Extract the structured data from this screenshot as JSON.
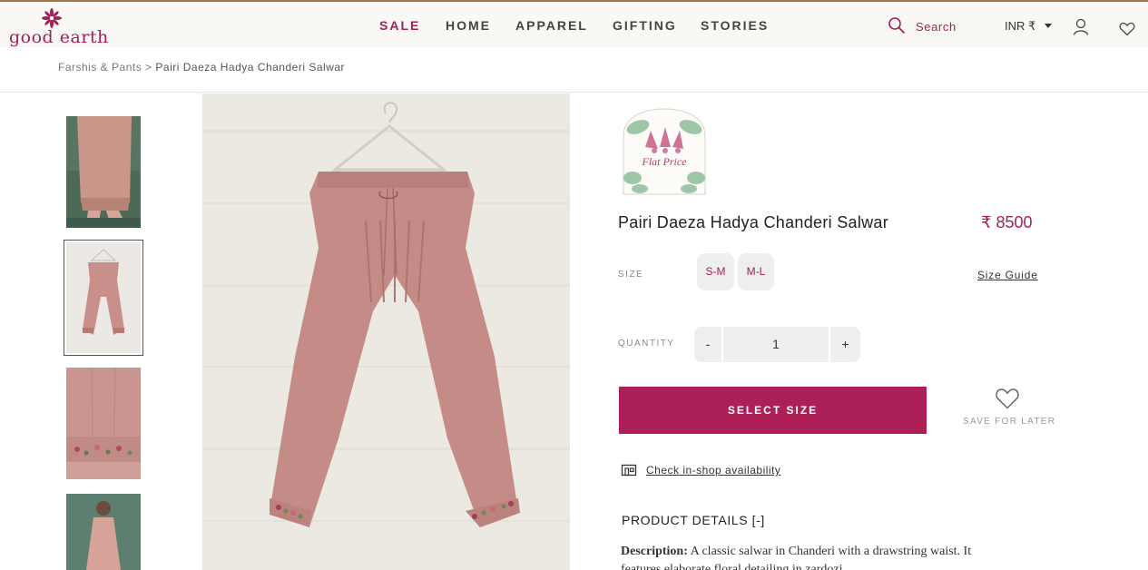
{
  "brand": {
    "name": "good earth"
  },
  "nav": {
    "sale": "SALE",
    "home": "HOME",
    "apparel": "APPAREL",
    "gifting": "GIFTING",
    "stories": "STORIES"
  },
  "header": {
    "search_label": "Search",
    "currency": "INR ₹"
  },
  "breadcrumb": {
    "parent": "Farshis & Pants",
    "separator": ">",
    "current": "Pairi Daeza Hadya Chanderi Salwar"
  },
  "badge": {
    "text": "Flat Price"
  },
  "product": {
    "title": "Pairi Daeza Hadya Chanderi Salwar",
    "price": "₹ 8500"
  },
  "size": {
    "label": "SIZE",
    "options": [
      "S-M",
      "M-L"
    ],
    "guide": "Size Guide"
  },
  "quantity": {
    "label": "QUANTITY",
    "minus": "-",
    "value": "1",
    "plus": "+"
  },
  "actions": {
    "select_size": "SELECT SIZE",
    "save_for_later": "SAVE FOR LATER",
    "check_availability": "Check in-shop availability"
  },
  "details": {
    "heading": "PRODUCT DETAILS [-]",
    "description_label": "Description:",
    "description_text": "A classic salwar in Chanderi with a drawstring waist. It features elaborate floral detailing in zardozi"
  },
  "icons": {
    "search": "search-icon",
    "user": "user-icon",
    "wishlist": "heart-icon",
    "caret": "chevron-down-icon",
    "shop": "store-icon"
  },
  "colors": {
    "accent": "#ac1f57",
    "text_accent": "#a1225b",
    "header_bg": "#f9f8f5",
    "pill_bg": "#eeeeec"
  }
}
